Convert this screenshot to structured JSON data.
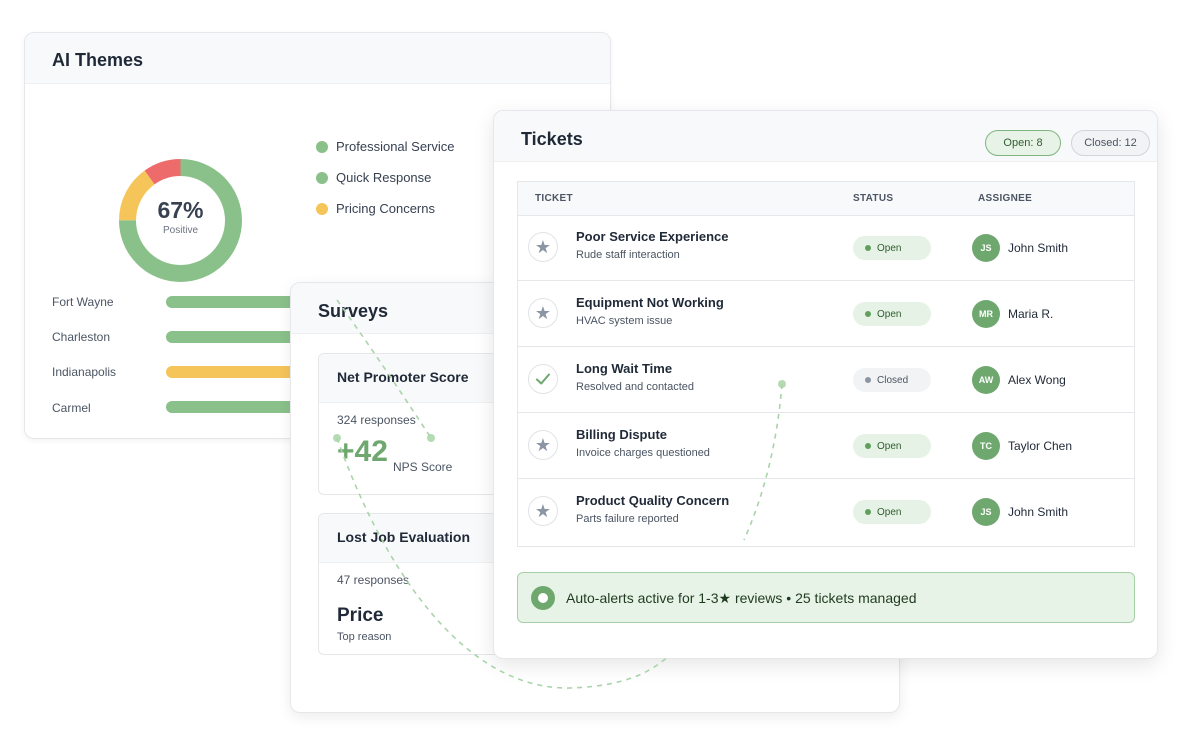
{
  "ai_themes": {
    "title": "AI Themes",
    "donut": {
      "percent_label": "67%",
      "caption": "Positive",
      "segments": [
        {
          "name": "positive",
          "value": 0.75,
          "color": "#8ac08a"
        },
        {
          "name": "neutral",
          "value": 0.15,
          "color": "#f5c55a"
        },
        {
          "name": "negative",
          "value": 0.1,
          "color": "#ee6b6b"
        }
      ]
    },
    "legend": [
      {
        "label": "Professional Service",
        "color": "#8ac08a"
      },
      {
        "label": "Quick Response",
        "color": "#8ac08a"
      },
      {
        "label": "Pricing Concerns",
        "color": "#f5c55a"
      }
    ],
    "cities": [
      {
        "name": "Fort Wayne",
        "color": "#8ac08a"
      },
      {
        "name": "Charleston",
        "color": "#8ac08a"
      },
      {
        "name": "Indianapolis",
        "color": "#f5c55a"
      },
      {
        "name": "Carmel",
        "color": "#8ac08a"
      }
    ]
  },
  "surveys": {
    "title": "Surveys",
    "nps": {
      "title": "Net Promoter Score",
      "responses": "324 responses",
      "score": "+42",
      "score_label": "NPS Score"
    },
    "lost_job": {
      "title": "Lost Job Evaluation",
      "responses": "47 responses",
      "reason": "Price",
      "reason_label": "Top reason"
    }
  },
  "tickets": {
    "title": "Tickets",
    "open_pill": "Open: 8",
    "closed_pill": "Closed: 12",
    "columns": [
      "TICKET",
      "STATUS",
      "ASSIGNEE"
    ],
    "rows": [
      {
        "title": "Poor Service Experience",
        "subtitle": "Rude staff interaction",
        "status": "Open",
        "initials": "JS",
        "assignee": "John Smith",
        "icon": "star-icon"
      },
      {
        "title": "Equipment Not Working",
        "subtitle": "HVAC system issue",
        "status": "Open",
        "initials": "MR",
        "assignee": "Maria R.",
        "icon": "star-icon"
      },
      {
        "title": "Long Wait Time",
        "subtitle": "Resolved and contacted",
        "status": "Closed",
        "initials": "AW",
        "assignee": "Alex Wong",
        "icon": "check-icon"
      },
      {
        "title": "Billing Dispute",
        "subtitle": "Invoice charges questioned",
        "status": "Open",
        "initials": "TC",
        "assignee": "Taylor Chen",
        "icon": "star-icon"
      },
      {
        "title": "Product Quality Concern",
        "subtitle": "Parts failure reported",
        "status": "Open",
        "initials": "JS",
        "assignee": "John Smith",
        "icon": "star-icon"
      }
    ],
    "alert_text": "Auto-alerts active for 1-3★ reviews • 25 tickets managed",
    "accent_color": "#6fa86f"
  }
}
